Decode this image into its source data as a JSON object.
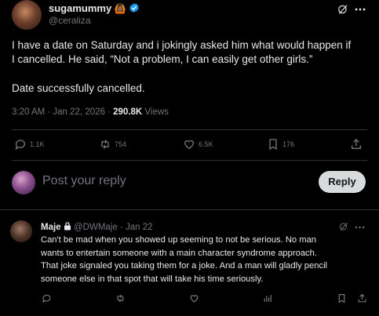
{
  "colors": {
    "background": "#000000",
    "text": "#e7e9ea",
    "muted": "#71767b",
    "verified": "#1d9bf0",
    "divider": "#2f3336",
    "reply_button": "#d7dbdc"
  },
  "post": {
    "author_name": "sugamummy",
    "author_emoji": "🙆🏾",
    "handle": "@ceraliza",
    "text_line1": "I have a date on Saturday and i jokingly asked him what would happen if",
    "text_line2": "I cancelled. He said, “Not a problem, I can easily get other girls.”",
    "text_line3": "Date successfully cancelled.",
    "timestamp": "3:20 AM · Jan 22, 2026 · ",
    "views_count": "290.8K",
    "views_label": " Views",
    "stats": {
      "replies": "1.1K",
      "reposts": "754",
      "likes": "6.5K",
      "bookmarks": "176"
    }
  },
  "reply_box": {
    "placeholder": "Post your reply",
    "button_label": "Reply"
  },
  "reply": {
    "author_name": "Maje",
    "handle": "@DWMaje",
    "date": " · Jan 22",
    "lines": [
      "Can't be mad when you showed up seeming to not be serious. No man",
      "wants to entertain someone with a main character syndrome approach.",
      "That joke signaled you taking them for a joke. And a man will gladly pencil",
      "someone else in that spot that will take his time seriously."
    ]
  }
}
